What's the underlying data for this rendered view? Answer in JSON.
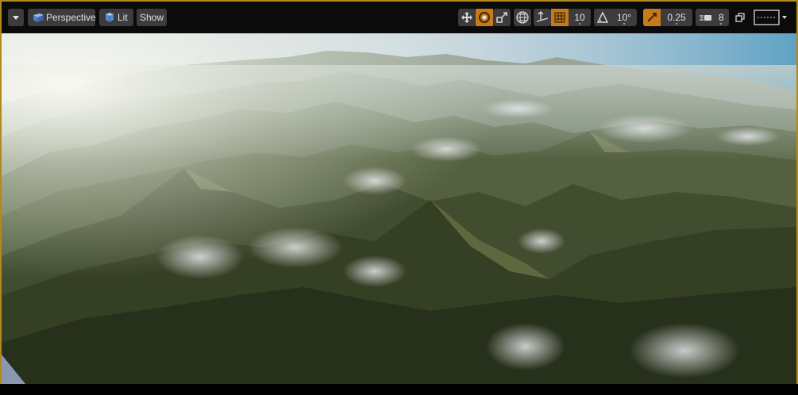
{
  "toolbar": {
    "view_mode": "Perspective",
    "lighting_mode": "Lit",
    "show_label": "Show",
    "grid_snap_value": "10",
    "rotation_snap_value": "10°",
    "scale_snap_value": "0.25",
    "camera_speed_value": "8"
  },
  "colors": {
    "accent": "#c87a1b",
    "frame_border": "#b08a1e",
    "button_bg": "#3c3c3c",
    "toolbar_bg": "#0b0b0b"
  },
  "icons": {
    "menu": "chevron-down-icon",
    "perspective": "perspective-cube-icon",
    "lit": "lit-sphere-icon",
    "translate": "translate-icon",
    "rotate": "rotate-icon",
    "scale": "scale-icon",
    "world_local": "globe-icon",
    "surface_snap": "surface-snap-icon",
    "grid_snap": "grid-icon",
    "rotation_snap": "angle-icon",
    "scale_snap": "scale-snap-icon",
    "camera_speed": "camera-speed-icon",
    "maximize": "maximize-icon",
    "layout": "layout-icon"
  }
}
